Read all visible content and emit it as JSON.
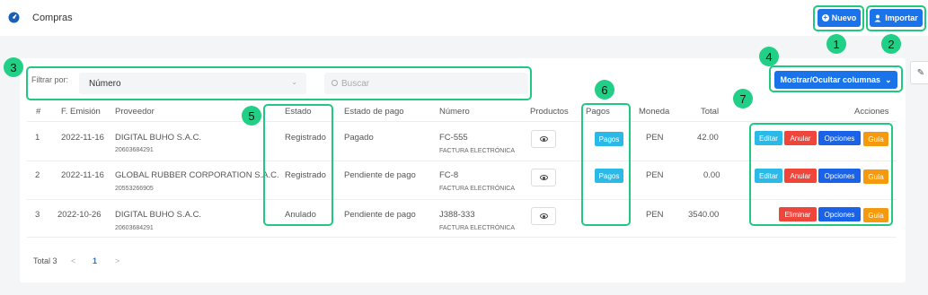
{
  "header": {
    "breadcrumb": "Compras",
    "new_button": "Nuevo",
    "import_button": "Importar"
  },
  "filter": {
    "label": "Filtrar por:",
    "selected": "Número",
    "search_placeholder": "Buscar",
    "columns_button": "Mostrar/Ocultar columnas"
  },
  "table": {
    "headers": [
      "#",
      "F. Emisión",
      "Proveedor",
      "Estado",
      "Estado de pago",
      "Número",
      "Productos",
      "Pagos",
      "Moneda",
      "Total",
      "Acciones"
    ],
    "rows": [
      {
        "num": "1",
        "date": "2022-11-16",
        "provider": "DIGITAL BUHO S.A.C.",
        "ruc": "20603684291",
        "status": "Registrado",
        "pay_status": "Pagado",
        "number": "FC-555",
        "doc_type": "FACTURA ELECTRÓNICA",
        "payments": "Pagos",
        "currency": "PEN",
        "total": "42.00"
      },
      {
        "num": "2",
        "date": "2022-11-16",
        "provider": "GLOBAL RUBBER CORPORATION S.A.C.",
        "ruc": "20553266905",
        "status": "Registrado",
        "pay_status": "Pendiente de pago",
        "number": "FC-8",
        "doc_type": "FACTURA ELECTRÓNICA",
        "payments": "Pagos",
        "currency": "PEN",
        "total": "0.00"
      },
      {
        "num": "3",
        "date": "2022-10-26",
        "provider": "DIGITAL BUHO S.A.C.",
        "ruc": "20603684291",
        "status": "Anulado",
        "pay_status": "Pendiente de pago",
        "number": "J388-333",
        "doc_type": "FACTURA ELECTRÓNICA",
        "currency": "PEN",
        "total": "3540.00"
      }
    ],
    "actions": {
      "edit": "Editar",
      "void": "Anular",
      "options": "Opciones",
      "guide": "Guía",
      "delete": "Eliminar"
    }
  },
  "pagination": {
    "total": "Total 3",
    "prev": "<",
    "page": "1",
    "next": ">"
  },
  "annotations": [
    "1",
    "2",
    "3",
    "4",
    "5",
    "6",
    "7"
  ],
  "colors": {
    "accent": "#1a73e8",
    "highlight": "#21c882",
    "cyan": "#2bb9e8",
    "red": "#f0453a",
    "orange": "#f59a0f"
  },
  "icons": {
    "logo": "dashboard-gauge-icon",
    "new": "plus-circle-icon",
    "import": "upload-user-icon",
    "search": "search-icon",
    "chevron": "chevron-down-icon",
    "products": "eye-icon",
    "settings": "paint-brush-icon"
  }
}
